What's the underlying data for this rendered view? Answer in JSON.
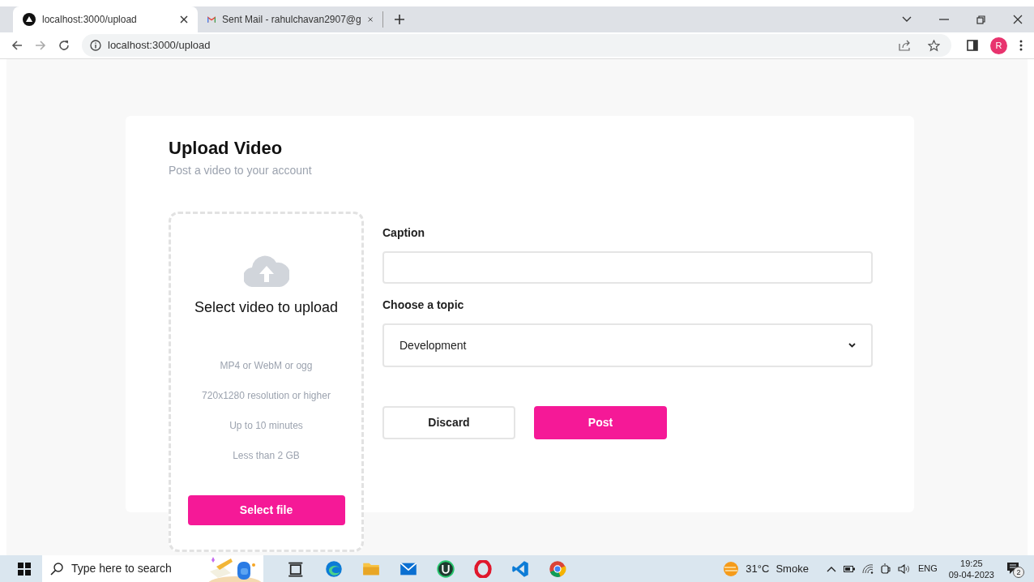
{
  "browser": {
    "tabs": [
      {
        "title": "localhost:3000/upload",
        "selected": true
      },
      {
        "title": "Sent Mail - rahulchavan2907@g",
        "selected": false
      }
    ],
    "address": "localhost:3000/upload",
    "profile_initial": "R"
  },
  "upload": {
    "title": "Upload Video",
    "subtitle": "Post a video to your account",
    "dropzone": {
      "heading": "Select video to upload",
      "requirements": [
        "MP4 or WebM or ogg",
        "720x1280 resolution or higher",
        "Up to 10 minutes",
        "Less than 2 GB"
      ],
      "button": "Select file"
    },
    "caption": {
      "label": "Caption"
    },
    "topic": {
      "label": "Choose a topic",
      "value": "Development"
    },
    "buttons": [
      {
        "label": "Discard",
        "kind": "secondary"
      },
      {
        "label": "Post",
        "kind": "primary"
      }
    ]
  },
  "taskbar": {
    "search_placeholder": "Type here to search",
    "weather": {
      "temperature": "31°C",
      "condition": "Smoke"
    },
    "language": "ENG",
    "time": "19:25",
    "date": "09-04-2023",
    "notifications": "2"
  }
}
